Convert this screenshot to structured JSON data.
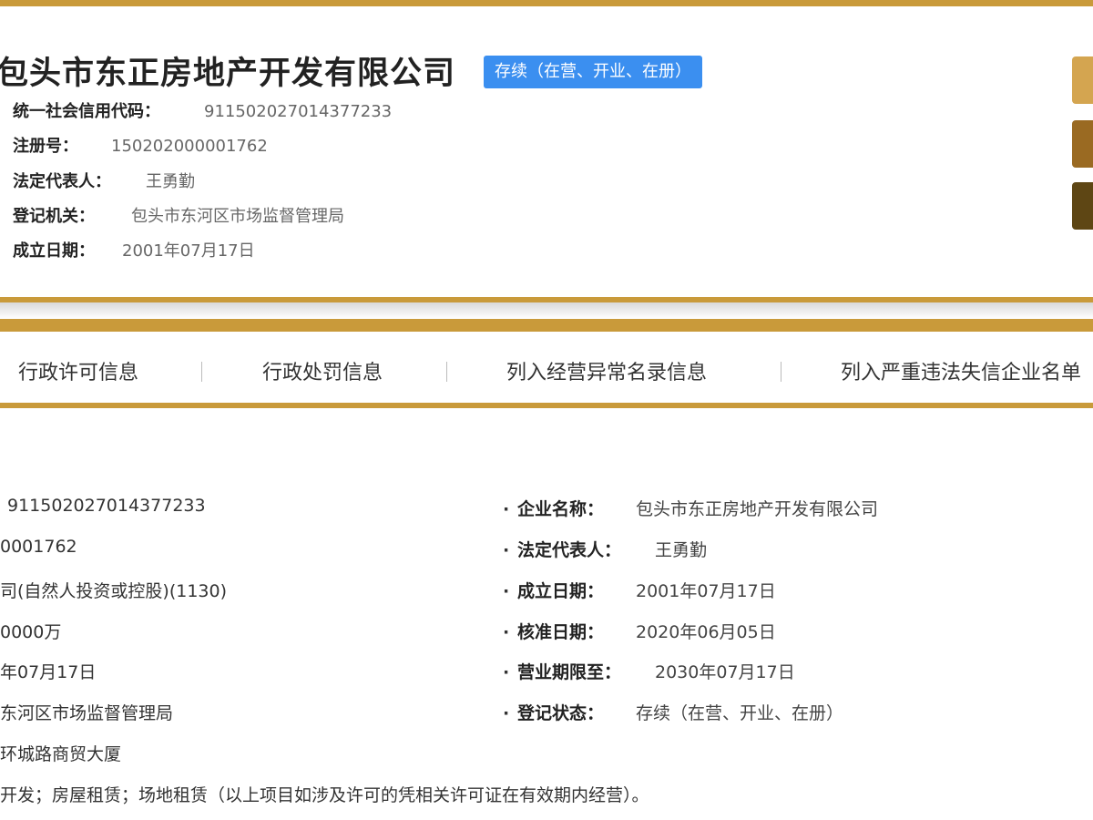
{
  "header": {
    "company_name": "包头市东正房地产开发有限公司",
    "status": "存续（在营、开业、在册）",
    "fields": [
      {
        "label": "统一社会信用代码：",
        "value": "911502027014377233"
      },
      {
        "label": "注册号：",
        "value": "150202000001762"
      },
      {
        "label": "法定代表人：",
        "value": "王勇勤"
      },
      {
        "label": "登记机关：",
        "value": "包头市东河区市场监督管理局"
      },
      {
        "label": "成立日期：",
        "value": "2001年07月17日"
      }
    ]
  },
  "tabs": [
    {
      "label": "行政许可信息"
    },
    {
      "label": "行政处罚信息"
    },
    {
      "label": "列入经营异常名录信息"
    },
    {
      "label": "列入严重违法失信企业名单"
    }
  ],
  "details": {
    "left_values": [
      "911502027014377233",
      "0001762",
      "司(自然人投资或控股)(1130)",
      "0000万",
      "年07月17日",
      "东河区市场监督管理局",
      "环城路商贸大厦",
      "开发；房屋租赁；场地租赁（以上项目如涉及许可的凭相关许可证在有效期内经营）。"
    ],
    "right_fields": [
      {
        "label": "企业名称：",
        "value": "包头市东正房地产开发有限公司"
      },
      {
        "label": "法定代表人：",
        "value": "王勇勤"
      },
      {
        "label": "成立日期：",
        "value": "2001年07月17日"
      },
      {
        "label": "核准日期：",
        "value": "2020年06月05日"
      },
      {
        "label": "营业期限至：",
        "value": "2030年07月17日"
      },
      {
        "label": "登记状态：",
        "value": "存续（在营、开业、在册）"
      }
    ]
  },
  "colors": {
    "gold": "#c99a3a",
    "badge_blue": "#3b8ff0"
  }
}
